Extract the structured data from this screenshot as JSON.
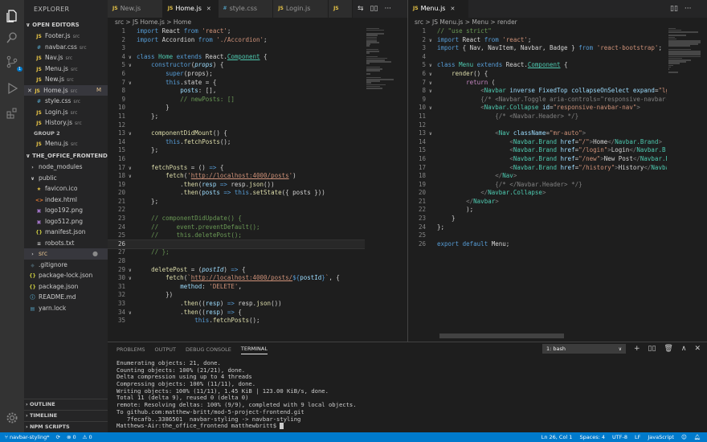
{
  "sidebar": {
    "title": "EXPLORER",
    "open_editors": "OPEN EDITORS",
    "group1": [
      {
        "icon": "JS",
        "name": "Footer.js",
        "dir": "src"
      },
      {
        "icon": "#",
        "name": "navbar.css",
        "dir": "src"
      },
      {
        "icon": "JS",
        "name": "Nav.js",
        "dir": "src"
      },
      {
        "icon": "JS",
        "name": "Menu.js",
        "dir": "src"
      },
      {
        "icon": "JS",
        "name": "New.js",
        "dir": "src"
      },
      {
        "icon": "JS",
        "name": "Home.js",
        "dir": "src",
        "mark": "M"
      },
      {
        "icon": "#",
        "name": "style.css",
        "dir": "src"
      },
      {
        "icon": "JS",
        "name": "Login.js",
        "dir": "src"
      },
      {
        "icon": "JS",
        "name": "History.js",
        "dir": "src"
      }
    ],
    "group2_title": "GROUP 2",
    "group2": [
      {
        "icon": "JS",
        "name": "Menu.js",
        "dir": "src"
      }
    ],
    "project": "THE_OFFICE_FRONTEND",
    "tree": [
      {
        "name": "node_modules",
        "type": "folder"
      },
      {
        "name": "public",
        "type": "folder-open"
      },
      {
        "name": "favicon.ico",
        "type": "ico"
      },
      {
        "name": "index.html",
        "type": "html"
      },
      {
        "name": "logo192.png",
        "type": "img"
      },
      {
        "name": "logo512.png",
        "type": "img"
      },
      {
        "name": "manifest.json",
        "type": "json"
      },
      {
        "name": "robots.txt",
        "type": "txt"
      },
      {
        "name": "src",
        "type": "folder"
      },
      {
        "name": ".gitignore",
        "type": "git"
      },
      {
        "name": "package-lock.json",
        "type": "json"
      },
      {
        "name": "package.json",
        "type": "json"
      },
      {
        "name": "README.md",
        "type": "md"
      },
      {
        "name": "yarn.lock",
        "type": "lock"
      }
    ],
    "bottom": [
      "OUTLINE",
      "TIMELINE",
      "NPM SCRIPTS"
    ]
  },
  "left_tabs": [
    {
      "label": "New.js",
      "icon": "JS"
    },
    {
      "label": "Home.js",
      "icon": "JS",
      "active": true
    },
    {
      "label": "style.css",
      "icon": "#"
    },
    {
      "label": "Login.js",
      "icon": "JS"
    },
    {
      "label": "",
      "icon": "JS"
    }
  ],
  "right_tabs": [
    {
      "label": "Menu.js",
      "icon": "JS",
      "active": true
    }
  ],
  "left_breadcrumb": "src  >  JS Home.js  >  Home",
  "right_breadcrumb": "src  >  JS Menu.js  >  Menu  >  render",
  "left_code": [
    {
      "n": "1",
      "h": "<span class='k'>import</span> React <span class='k'>from</span> <span class='s'>'react'</span>;"
    },
    {
      "n": "2",
      "h": "<span class='k'>import</span> Accordion <span class='k'>from</span> <span class='s'>'./Accordion'</span>;"
    },
    {
      "n": "3",
      "h": ""
    },
    {
      "n": "4",
      "h": "<span class='k'>class</span> <span class='c'>Home</span> <span class='k'>extends</span> React.<span class='c u'>Component</span> {"
    },
    {
      "n": "5",
      "h": "    <span class='k'>constructor</span>(<span class='v'><i>props</i></span>) {"
    },
    {
      "n": "6",
      "h": "        <span class='k'>super</span>(props);"
    },
    {
      "n": "7",
      "h": "        <span class='k'>this</span>.state = {"
    },
    {
      "n": "8",
      "h": "            <span class='v'>posts</span>: [],"
    },
    {
      "n": "9",
      "h": "            <span class='cm'>// newPosts: []</span>"
    },
    {
      "n": "10",
      "h": "        }"
    },
    {
      "n": "11",
      "h": "    };"
    },
    {
      "n": "12",
      "h": ""
    },
    {
      "n": "13",
      "h": "    <span class='f'>componentDidMount</span>() {"
    },
    {
      "n": "14",
      "h": "        <span class='k'>this</span>.<span class='f'>fetchPosts</span>();"
    },
    {
      "n": "15",
      "h": "    };"
    },
    {
      "n": "16",
      "h": ""
    },
    {
      "n": "17",
      "h": "    <span class='f'>fetchPosts</span> = () <span class='k'>=></span> {"
    },
    {
      "n": "18",
      "h": "        <span class='f'>fetch</span>(<span class='s'>'<span class=\"u\">http://localhost:4000/posts</span>'</span>)"
    },
    {
      "n": "19",
      "h": "            .<span class='f'>then</span>(<span class='v'>resp</span> <span class='k'>=></span> resp.<span class='f'>json</span>())"
    },
    {
      "n": "20",
      "h": "            .<span class='f'>then</span>(<span class='v'>posts</span> <span class='k'>=></span> <span class='k'>this</span>.<span class='f'>setState</span>({ posts }))"
    },
    {
      "n": "21",
      "h": "    };"
    },
    {
      "n": "22",
      "h": ""
    },
    {
      "n": "23",
      "h": "    <span class='cm'>// componentDidUpdate() {</span>"
    },
    {
      "n": "24",
      "h": "    <span class='cm'>//     event.preventDefault();</span>"
    },
    {
      "n": "25",
      "h": "    <span class='cm'>//     this.deletePost();</span>"
    },
    {
      "n": "26",
      "h": "",
      "cur": true
    },
    {
      "n": "27",
      "h": "    <span class='cm'>// };</span>"
    },
    {
      "n": "28",
      "h": ""
    },
    {
      "n": "29",
      "h": "    <span class='f'>deletePost</span> = (<span class='v'><i>postId</i></span>) <span class='k'>=></span> {"
    },
    {
      "n": "30",
      "h": "        <span class='f'>fetch</span>(<span class='s'>`<span class=\"u\">http://localhost:4000/posts/</span></span><span class='k'>${</span><span class='v'>postId</span><span class='k'>}</span><span class='s'>`</span>, {"
    },
    {
      "n": "31",
      "h": "            <span class='v'>method</span>: <span class='s'>'DELETE'</span>,"
    },
    {
      "n": "32",
      "h": "        })"
    },
    {
      "n": "33",
      "h": "            .<span class='f'>then</span>((<span class='v'>resp</span>) <span class='k'>=></span> resp.<span class='f'>json</span>())"
    },
    {
      "n": "34",
      "h": "            .<span class='f'>then</span>((<span class='v'>resp</span>) <span class='k'>=></span> {"
    },
    {
      "n": "35",
      "h": "                <span class='k'>this</span>.<span class='f'>fetchPosts</span>();"
    }
  ],
  "right_code": [
    {
      "n": "1",
      "h": "<span class='cm'>// \"use strict\"</span>"
    },
    {
      "n": "2",
      "h": "<span class='k'>import</span> React <span class='k'>from</span> <span class='s'>'react'</span>;"
    },
    {
      "n": "3",
      "h": "<span class='k'>import</span> { Nav, NavItem, Navbar, Badge } <span class='k'>from</span> <span class='s'>'react-bootstrap'</span>;"
    },
    {
      "n": "4",
      "h": ""
    },
    {
      "n": "5",
      "h": "<span class='k'>class</span> <span class='c'>Menu</span> <span class='k'>extends</span> React.<span class='c u'>Component</span> {"
    },
    {
      "n": "6",
      "h": "    <span class='f'>render</span>() {"
    },
    {
      "n": "7",
      "h": "        <span class='p'>return</span> ("
    },
    {
      "n": "8",
      "h": "            <span class='gr'>&lt;</span><span class='c'>Navbar</span> <span class='v'>inverse</span> <span class='v'>FixedTop</span> <span class='v'>collapseOnSelect</span> <span class='v'>expand</span>=<span class='s'>\"lg</span>"
    },
    {
      "n": "9",
      "h": "            <span class='gr'>{/* &lt;Navbar.Toggle aria-controls=\"responsive-navbar-</span>"
    },
    {
      "n": "10",
      "h": "            <span class='gr'>&lt;</span><span class='c'>Navbar.Collapse</span> <span class='v'>id</span>=<span class='s'>\"responsive-navbar-nav\"</span><span class='gr'>&gt;</span>"
    },
    {
      "n": "11",
      "h": "                <span class='gr'>{/* &lt;Navbar.Header&gt; */}</span>"
    },
    {
      "n": "12",
      "h": ""
    },
    {
      "n": "13",
      "h": "                <span class='gr'>&lt;</span><span class='c'>Nav</span> <span class='v'>className</span>=<span class='s'>\"mr-auto\"</span><span class='gr'>&gt;</span>"
    },
    {
      "n": "14",
      "h": "                    <span class='gr'>&lt;</span><span class='c'>Navbar.Brand</span> <span class='v'>href</span>=<span class='s'>\"/\"</span><span class='gr'>&gt;</span>Home<span class='gr'>&lt;/</span><span class='c'>Navbar.Brand</span><span class='gr'>&gt;</span>"
    },
    {
      "n": "15",
      "h": "                    <span class='gr'>&lt;</span><span class='c'>Navbar.Brand</span> <span class='v'>href</span>=<span class='s'>\"/login\"</span><span class='gr'>&gt;</span>Login<span class='gr'>&lt;/</span><span class='c'>Navbar.B</span>"
    },
    {
      "n": "16",
      "h": "                    <span class='gr'>&lt;</span><span class='c'>Navbar.Brand</span> <span class='v'>href</span>=<span class='s'>\"/new\"</span><span class='gr'>&gt;</span>New Post<span class='gr'>&lt;/</span><span class='c'>Navbar.B</span>"
    },
    {
      "n": "17",
      "h": "                    <span class='gr'>&lt;</span><span class='c'>Navbar.Brand</span> <span class='v'>href</span>=<span class='s'>\"/history\"</span><span class='gr'>&gt;</span>History<span class='gr'>&lt;/</span><span class='c'>Navba</span>"
    },
    {
      "n": "18",
      "h": "                <span class='gr'>&lt;/</span><span class='c'>Nav</span><span class='gr'>&gt;</span>"
    },
    {
      "n": "19",
      "h": "                <span class='gr'>{/* &lt;/Navbar.Header&gt; */}</span>"
    },
    {
      "n": "20",
      "h": "            <span class='gr'>&lt;/</span><span class='c'>Navbar.Collapse</span><span class='gr'>&gt;</span>"
    },
    {
      "n": "21",
      "h": "        <span class='gr'>&lt;/</span><span class='c'>Navbar</span><span class='gr'>&gt;</span>"
    },
    {
      "n": "22",
      "h": "        );"
    },
    {
      "n": "23",
      "h": "    }"
    },
    {
      "n": "24",
      "h": "};"
    },
    {
      "n": "25",
      "h": ""
    },
    {
      "n": "26",
      "h": "<span class='k'>export</span> <span class='k'>default</span> Menu;"
    }
  ],
  "left_folds": {
    "4": "∨",
    "5": "∨",
    "7": "∨",
    "13": "∨",
    "17": "∨",
    "18": "∨",
    "29": "∨",
    "30": "∨",
    "34": "∨"
  },
  "right_folds": {
    "2": "∨",
    "5": "∨",
    "6": "∨",
    "7": "∨",
    "8": "∨",
    "10": "∨",
    "13": "∨"
  },
  "panel": {
    "tabs": [
      "PROBLEMS",
      "OUTPUT",
      "DEBUG CONSOLE",
      "TERMINAL"
    ],
    "active": "TERMINAL",
    "shell": "1: bash",
    "lines": [
      "Enumerating objects: 21, done.",
      "Counting objects: 100% (21/21), done.",
      "Delta compression using up to 4 threads",
      "Compressing objects: 100% (11/11), done.",
      "Writing objects: 100% (11/11), 1.45 KiB | 123.00 KiB/s, done.",
      "Total 11 (delta 9), reused 0 (delta 0)",
      "remote: Resolving deltas: 100% (9/9), completed with 9 local objects.",
      "To github.com:matthew-britt/mod-5-project-frontend.git",
      "   7fecafb..3386501  navbar-styling -> navbar-styling"
    ],
    "prompt": "Matthews-Air:the_office_frontend matthewbritt$ "
  },
  "status": {
    "branch": "navbar-styling*",
    "sync": "⟳",
    "errors": "⊗ 0",
    "warnings": "⚠ 0",
    "position": "Ln 26, Col 1",
    "spaces": "Spaces: 4",
    "encoding": "UTF-8",
    "eol": "LF",
    "language": "JavaScript"
  }
}
